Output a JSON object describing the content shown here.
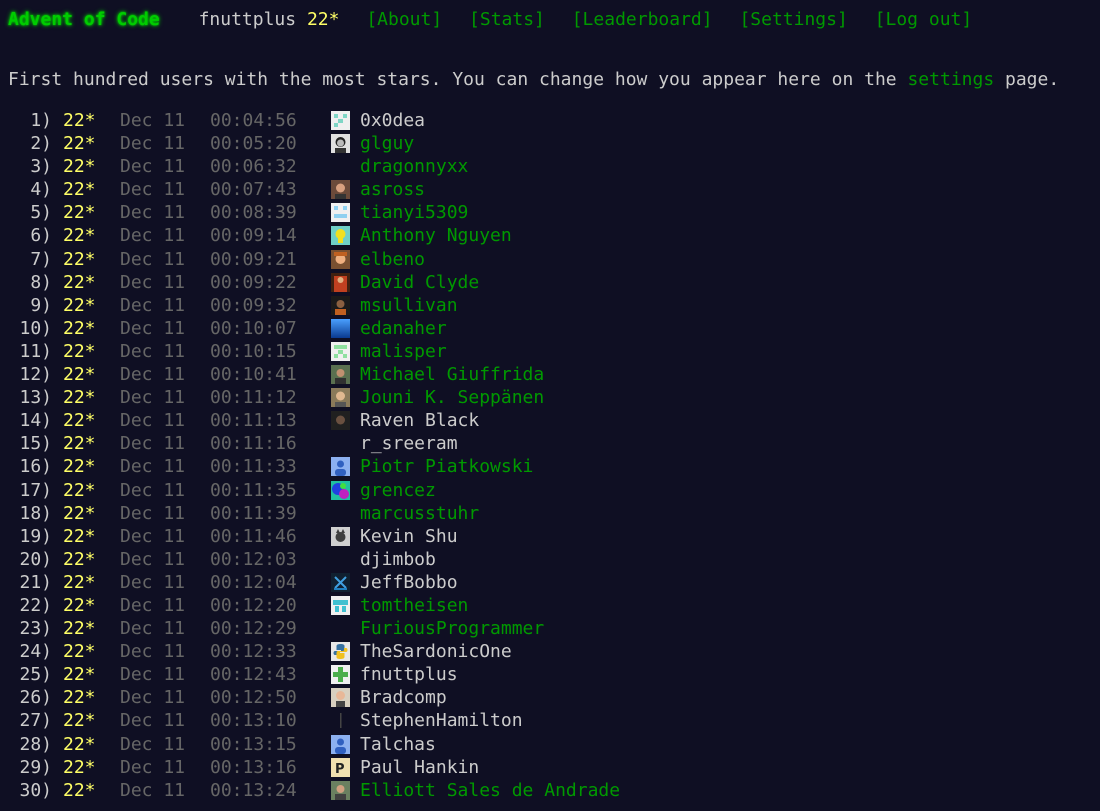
{
  "header": {
    "logo": "Advent of Code",
    "user_name": "fnuttplus",
    "user_stars": "22*",
    "nav": [
      "[About]",
      "[Stats]",
      "[Leaderboard]",
      "[Settings]",
      "[Log out]"
    ]
  },
  "intro": {
    "before": "First hundred users with the most stars. You can change how you appear here on the ",
    "link": "settings",
    "after": " page."
  },
  "colors": {
    "background": "#0f0f23",
    "text": "#cccccc",
    "link_green": "#009900",
    "logo_green": "#00cc00",
    "star_yellow": "#ffff66",
    "muted": "#666666"
  },
  "leaderboard": [
    {
      "pos": "1)",
      "stars": "22*",
      "date": "Dec 11",
      "time": "00:04:56",
      "name": "0x0dea",
      "linked": false,
      "avatar": "identicon-cyan"
    },
    {
      "pos": "2)",
      "stars": "22*",
      "date": "Dec 11",
      "time": "00:05:20",
      "name": "glguy",
      "linked": true,
      "avatar": "photo-bw-face"
    },
    {
      "pos": "3)",
      "stars": "22*",
      "date": "Dec 11",
      "time": "00:06:32",
      "name": "dragonnyxx",
      "linked": true,
      "avatar": "none"
    },
    {
      "pos": "4)",
      "stars": "22*",
      "date": "Dec 11",
      "time": "00:07:43",
      "name": "asross",
      "linked": true,
      "avatar": "photo-face"
    },
    {
      "pos": "5)",
      "stars": "22*",
      "date": "Dec 11",
      "time": "00:08:39",
      "name": "tianyi5309",
      "linked": true,
      "avatar": "identicon-lightblue"
    },
    {
      "pos": "6)",
      "stars": "22*",
      "date": "Dec 11",
      "time": "00:09:14",
      "name": "Anthony Nguyen",
      "linked": true,
      "avatar": "cartoon-yellow"
    },
    {
      "pos": "7)",
      "stars": "22*",
      "date": "Dec 11",
      "time": "00:09:21",
      "name": "elbeno",
      "linked": true,
      "avatar": "photo-child"
    },
    {
      "pos": "8)",
      "stars": "22*",
      "date": "Dec 11",
      "time": "00:09:22",
      "name": "David Clyde",
      "linked": true,
      "avatar": "photo-red"
    },
    {
      "pos": "9)",
      "stars": "22*",
      "date": "Dec 11",
      "time": "00:09:32",
      "name": "msullivan",
      "linked": true,
      "avatar": "photo-dark"
    },
    {
      "pos": "10)",
      "stars": "22*",
      "date": "Dec 11",
      "time": "00:10:07",
      "name": "edanaher",
      "linked": true,
      "avatar": "gradient-blue"
    },
    {
      "pos": "11)",
      "stars": "22*",
      "date": "Dec 11",
      "time": "00:10:15",
      "name": "malisper",
      "linked": true,
      "avatar": "identicon-green"
    },
    {
      "pos": "12)",
      "stars": "22*",
      "date": "Dec 11",
      "time": "00:10:41",
      "name": "Michael Giuffrida",
      "linked": true,
      "avatar": "photo-outdoor"
    },
    {
      "pos": "13)",
      "stars": "22*",
      "date": "Dec 11",
      "time": "00:11:12",
      "name": "Jouni K. Seppänen",
      "linked": true,
      "avatar": "photo-face-2"
    },
    {
      "pos": "14)",
      "stars": "22*",
      "date": "Dec 11",
      "time": "00:11:13",
      "name": "Raven Black",
      "linked": false,
      "avatar": "photo-dark-2"
    },
    {
      "pos": "15)",
      "stars": "22*",
      "date": "Dec 11",
      "time": "00:11:16",
      "name": "r_sreeram",
      "linked": false,
      "avatar": "none"
    },
    {
      "pos": "16)",
      "stars": "22*",
      "date": "Dec 11",
      "time": "00:11:33",
      "name": "Piotr Piatkowski",
      "linked": true,
      "avatar": "default-person-blue"
    },
    {
      "pos": "17)",
      "stars": "22*",
      "date": "Dec 11",
      "time": "00:11:35",
      "name": "grencez",
      "linked": true,
      "avatar": "colorful-swirl"
    },
    {
      "pos": "18)",
      "stars": "22*",
      "date": "Dec 11",
      "time": "00:11:39",
      "name": "marcusstuhr",
      "linked": true,
      "avatar": "none"
    },
    {
      "pos": "19)",
      "stars": "22*",
      "date": "Dec 11",
      "time": "00:11:46",
      "name": "Kevin Shu",
      "linked": false,
      "avatar": "photo-cat"
    },
    {
      "pos": "20)",
      "stars": "22*",
      "date": "Dec 11",
      "time": "00:12:03",
      "name": "djimbob",
      "linked": false,
      "avatar": "none"
    },
    {
      "pos": "21)",
      "stars": "22*",
      "date": "Dec 11",
      "time": "00:12:04",
      "name": "JeffBobbo",
      "linked": false,
      "avatar": "logo-dark"
    },
    {
      "pos": "22)",
      "stars": "22*",
      "date": "Dec 11",
      "time": "00:12:20",
      "name": "tomtheisen",
      "linked": true,
      "avatar": "identicon-teal"
    },
    {
      "pos": "23)",
      "stars": "22*",
      "date": "Dec 11",
      "time": "00:12:29",
      "name": "FuriousProgrammer",
      "linked": true,
      "avatar": "none"
    },
    {
      "pos": "24)",
      "stars": "22*",
      "date": "Dec 11",
      "time": "00:12:33",
      "name": "TheSardonicOne",
      "linked": false,
      "avatar": "python-logo"
    },
    {
      "pos": "25)",
      "stars": "22*",
      "date": "Dec 11",
      "time": "00:12:43",
      "name": "fnuttplus",
      "linked": false,
      "avatar": "identicon-green-plus"
    },
    {
      "pos": "26)",
      "stars": "22*",
      "date": "Dec 11",
      "time": "00:12:50",
      "name": "Bradcomp",
      "linked": false,
      "avatar": "photo-face-3"
    },
    {
      "pos": "27)",
      "stars": "22*",
      "date": "Dec 11",
      "time": "00:13:10",
      "name": "StephenHamilton",
      "linked": false,
      "avatar": "thin-line"
    },
    {
      "pos": "28)",
      "stars": "22*",
      "date": "Dec 11",
      "time": "00:13:15",
      "name": "Talchas",
      "linked": false,
      "avatar": "default-person-blue"
    },
    {
      "pos": "29)",
      "stars": "22*",
      "date": "Dec 11",
      "time": "00:13:16",
      "name": "Paul Hankin",
      "linked": false,
      "avatar": "letter-p"
    },
    {
      "pos": "30)",
      "stars": "22*",
      "date": "Dec 11",
      "time": "00:13:24",
      "name": "Elliott Sales de Andrade",
      "linked": true,
      "avatar": "photo-outdoor-2"
    }
  ]
}
